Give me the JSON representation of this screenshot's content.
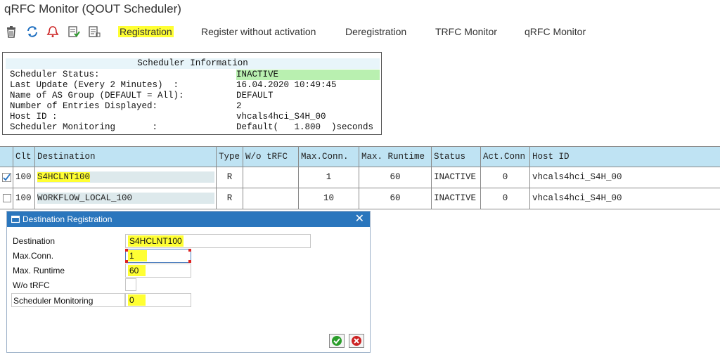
{
  "window": {
    "title": "qRFC Monitor (QOUT Scheduler)"
  },
  "toolbar": {
    "icons": [
      "trash-icon",
      "refresh-icon",
      "alert-icon",
      "activate-icon",
      "deactivate-icon"
    ],
    "buttons": {
      "registration": "Registration",
      "register_without_activation": "Register without activation",
      "deregistration": "Deregistration",
      "trfc_monitor": "TRFC Monitor",
      "qrfc_monitor": "qRFC Monitor"
    }
  },
  "scheduler_info": {
    "header": "Scheduler Information",
    "rows": [
      {
        "label": "Scheduler Status:",
        "value": "INACTIVE"
      },
      {
        "label": "Last Update (Every 2 Minutes)  :",
        "value": "16.04.2020 10:49:45"
      },
      {
        "label": "Name of AS Group (DEFAULT = All):",
        "value": "DEFAULT"
      },
      {
        "label": "Number of Entries Displayed:",
        "value": "2"
      },
      {
        "label": "Host ID :",
        "value": "vhcals4hci_S4H_00"
      },
      {
        "label": "Scheduler Monitoring       :",
        "value": "Default(   1.800  )seconds"
      }
    ]
  },
  "table": {
    "columns": [
      "Clt",
      "Destination",
      "Type",
      "W/o tRFC",
      "Max.Conn.",
      "Max. Runtime",
      "Status",
      "Act.Conn",
      "Host ID"
    ],
    "rows": [
      {
        "selected": true,
        "clt": "100",
        "destination": "S4HCLNT100",
        "type": "R",
        "wo_trfc": "",
        "max_conn": "1",
        "max_runtime": "60",
        "status": "INACTIVE",
        "act_conn": "0",
        "host_id": "vhcals4hci_S4H_00"
      },
      {
        "selected": false,
        "clt": "100",
        "destination": "WORKFLOW_LOCAL_100",
        "type": "R",
        "wo_trfc": "",
        "max_conn": "10",
        "max_runtime": "60",
        "status": "INACTIVE",
        "act_conn": "0",
        "host_id": "vhcals4hci_S4H_00"
      }
    ]
  },
  "dialog": {
    "title": "Destination Registration",
    "fields": {
      "destination": {
        "label": "Destination",
        "value": "S4HCLNT100"
      },
      "max_conn": {
        "label": "Max.Conn.",
        "value": "1"
      },
      "max_runtime": {
        "label": "Max. Runtime",
        "value": "60"
      },
      "wo_trfc": {
        "label": "W/o tRFC",
        "value": ""
      },
      "scheduler_monitoring": {
        "label": "Scheduler Monitoring",
        "value": "0"
      }
    }
  },
  "colors": {
    "highlight": "#ffff33",
    "header_blue": "#bfe3f3",
    "status_green": "#b9f0b0",
    "dialog_title": "#2a76bd"
  }
}
